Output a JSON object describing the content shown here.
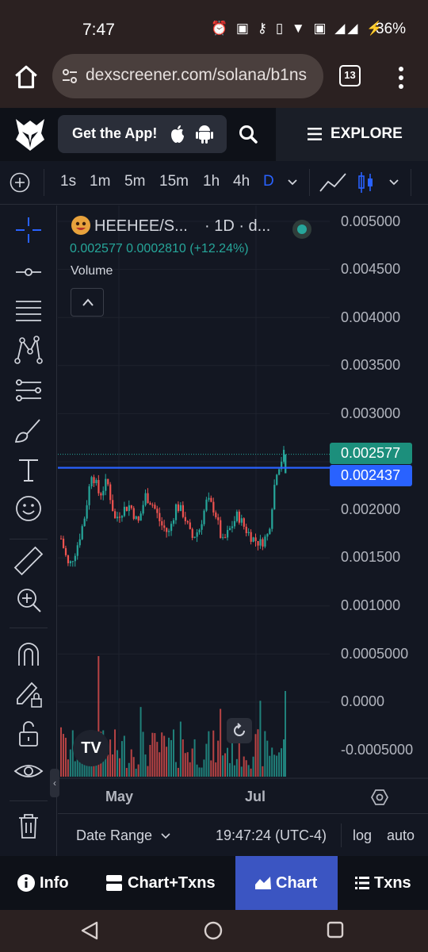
{
  "status_bar": {
    "time": "7:47",
    "icons": [
      "alarm-icon",
      "auto-icon",
      "key-icon",
      "vibrate-icon",
      "wifi-icon",
      "volte-icon",
      "signal-icon",
      "signal-icon",
      "charging-icon"
    ],
    "battery": "36%"
  },
  "browser": {
    "url": "dexscreener.com/solana/b1ns",
    "tab_count": "13"
  },
  "site_header": {
    "get_app_label": "Get the App!",
    "explore_label": "EXPLORE"
  },
  "timeframes": {
    "items": [
      "1s",
      "1m",
      "5m",
      "15m",
      "1h",
      "4h",
      "D"
    ],
    "active": "D"
  },
  "chart_legend": {
    "title": "HEEHEE/S...",
    "timeframe": "· 1D · d...",
    "ohlc": "0.002577  0.0002810 (+12.24%)",
    "volume_label": "Volume"
  },
  "price_axis": {
    "labels": [
      "0.005000",
      "0.004500",
      "0.004000",
      "0.003500",
      "0.003000",
      "0.002000",
      "0.001500",
      "0.001000",
      "0.0005000",
      "0.0000",
      "-0.0005000"
    ],
    "current_price": "0.002577",
    "line_price": "0.002437"
  },
  "time_axis": {
    "labels": [
      "May",
      "Jul"
    ]
  },
  "bottom_controls": {
    "date_range": "Date Range",
    "clock": "19:47:24 (UTC-4)",
    "log": "log",
    "auto": "auto"
  },
  "bottom_nav": {
    "info": "Info",
    "chart_txns": "Chart+Txns",
    "chart": "Chart",
    "txns": "Txns"
  },
  "colors": {
    "up": "#26a69a",
    "down": "#ef5350",
    "accent": "#2962ff",
    "active_tab": "#3b55c2"
  },
  "chart_data": {
    "type": "candlestick",
    "series": [
      {
        "name": "HEEHEE/SOL",
        "close_values": [
          0.0017,
          0.0014,
          0.0016,
          0.0019,
          0.0024,
          0.00215,
          0.0023,
          0.0019,
          0.002,
          0.00205,
          0.00185,
          0.00215,
          0.00205,
          0.00185,
          0.00175,
          0.00205,
          0.00195,
          0.0017,
          0.0018,
          0.0021,
          0.002,
          0.00165,
          0.0018,
          0.00195,
          0.0018,
          0.0017,
          0.00165,
          0.00175,
          0.0024,
          0.002577
        ]
      }
    ],
    "ylim": [
      -0.0005,
      0.005
    ],
    "current_price": 0.002577,
    "horizontal_line": 0.002437
  }
}
